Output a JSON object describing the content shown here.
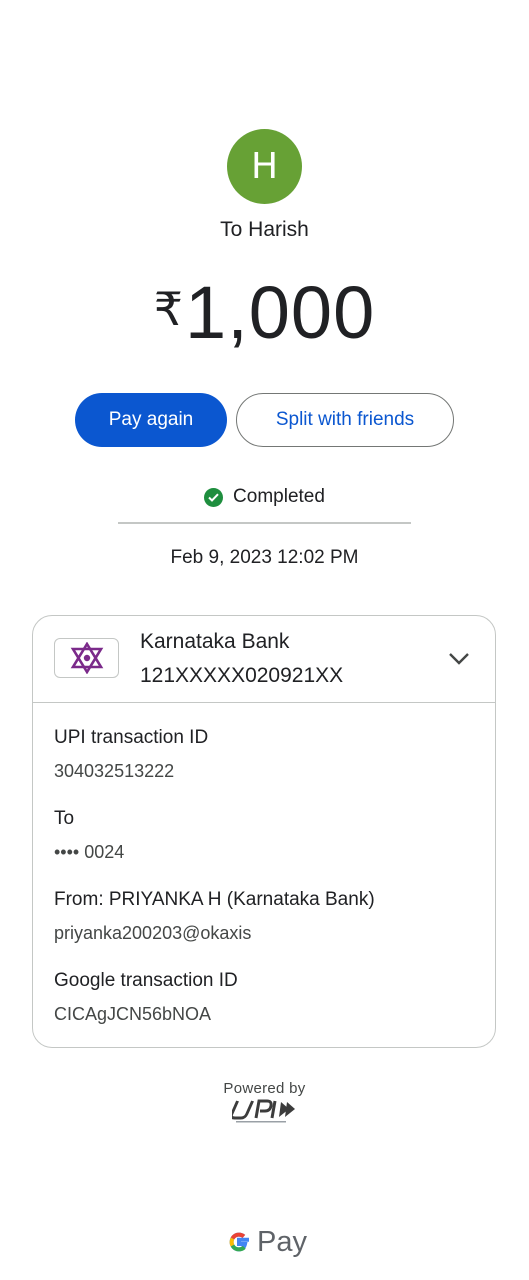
{
  "avatar": {
    "initial": "H",
    "color": "#67a135"
  },
  "payee": "To Harish",
  "amount": {
    "currency": "₹",
    "value": "1,000"
  },
  "actions": {
    "pay_again": "Pay again",
    "split": "Split with friends"
  },
  "status": {
    "icon": "check-circle-icon",
    "label": "Completed",
    "color": "#1e8e3e"
  },
  "datetime": "Feb 9, 2023 12:02 PM",
  "bank": {
    "logo_icon": "karnataka-bank-logo",
    "name": "Karnataka Bank",
    "account": "121XXXXX020921XX"
  },
  "details": {
    "upi_label": "UPI transaction ID",
    "upi_value": "304032513222",
    "to_label": "To",
    "to_value": "•••• 0024",
    "from_label": "From: PRIYANKA H (Karnataka Bank)",
    "from_value": "priyanka200203@okaxis",
    "google_label": "Google transaction ID",
    "google_value": "CICAgJCN56bNOA"
  },
  "footer": {
    "powered_by": "Powered by",
    "upi_logo": "upi-logo",
    "brand": "Pay"
  },
  "colors": {
    "accent": "#0b57d0",
    "border": "#c4c7c5"
  }
}
